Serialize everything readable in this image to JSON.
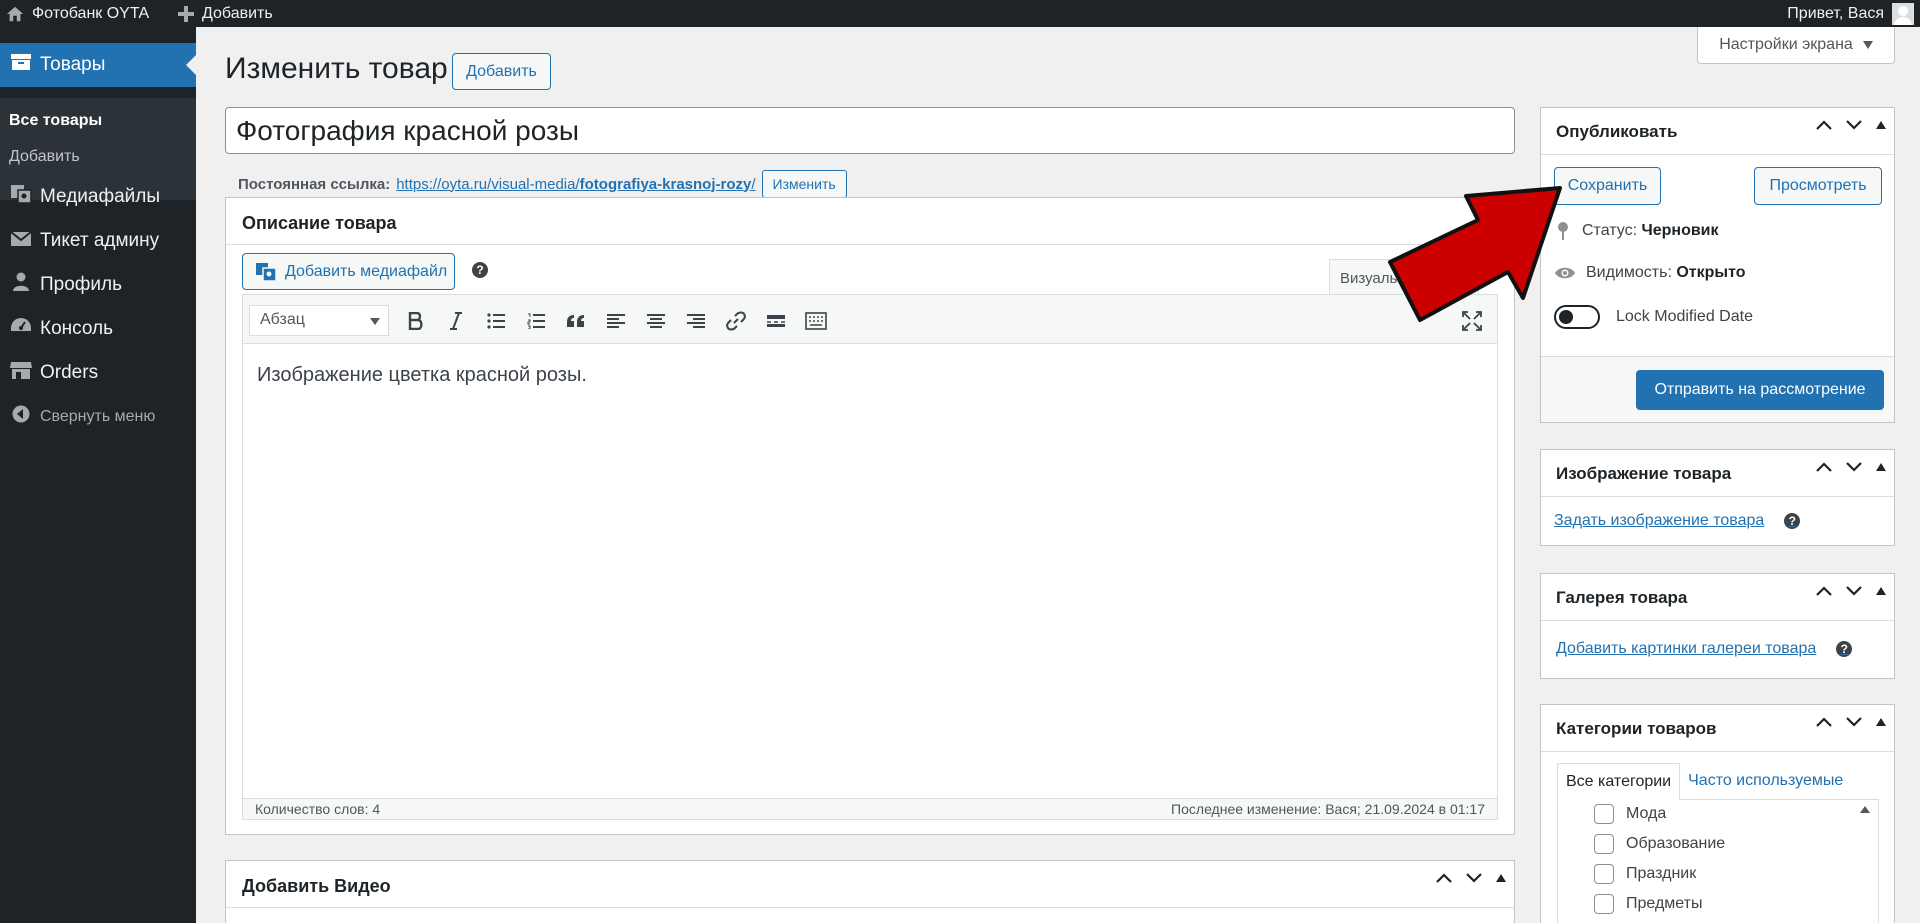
{
  "adminbar": {
    "site_name": "Фотобанк OYTA",
    "new_label": "Добавить",
    "greeting": "Привет, Вася"
  },
  "sidebar": {
    "items": [
      {
        "label": "Товары",
        "icon": "archive-icon"
      },
      {
        "label": "Медиафайлы",
        "icon": "media-icon"
      },
      {
        "label": "Тикет админу",
        "icon": "email-icon"
      },
      {
        "label": "Профиль",
        "icon": "user-icon"
      },
      {
        "label": "Консоль",
        "icon": "dashboard-icon"
      },
      {
        "label": "Orders",
        "icon": "store-icon"
      },
      {
        "label": "Свернуть меню",
        "icon": "collapse-icon"
      }
    ],
    "submenu": {
      "all_products": "Все товары",
      "add": "Добавить"
    }
  },
  "screen_options": {
    "label": "Настройки экрана"
  },
  "header": {
    "title": "Изменить товар",
    "add_new_label": "Добавить"
  },
  "post": {
    "title_value": "Фотография красной розы",
    "permalink_label": "Постоянная ссылка:",
    "permalink_base": "https://oyta.ru/visual-media/",
    "permalink_slug": "fotografiya-krasnoj-rozy",
    "permalink_end": "/",
    "permalink_edit": "Изменить"
  },
  "editor": {
    "box_title": "Описание товара",
    "add_media_label": "Добавить медиафайл",
    "tab_visual": "Визуально",
    "format_value": "Абзац",
    "content": "Изображение цветка красной розы.",
    "word_count": "Количество слов: 4",
    "last_edit": "Последнее изменение: Вася; 21.09.2024 в 01:17"
  },
  "video_box": {
    "title": "Добавить Видео"
  },
  "publish": {
    "title": "Опубликовать",
    "save_label": "Сохранить",
    "preview_label": "Просмотреть",
    "status_label": "Статус:",
    "status_value": "Черновик",
    "visibility_label": "Видимость:",
    "visibility_value": "Открыто",
    "lock_label": "Lock Modified Date",
    "submit_label": "Отправить на рассмотрение"
  },
  "product_image": {
    "title": "Изображение товара",
    "set_link": "Задать изображение товара"
  },
  "gallery": {
    "title": "Галерея товара",
    "add_link": "Добавить картинки галереи товара"
  },
  "categories": {
    "title": "Категории товаров",
    "tab_all": "Все категории",
    "tab_popular": "Часто используемые",
    "items": [
      "Мода",
      "Образование",
      "Праздник",
      "Предметы"
    ]
  },
  "colors": {
    "accent": "#2271b1",
    "admin_dark": "#1d2327",
    "arrow": "#cc0000"
  }
}
